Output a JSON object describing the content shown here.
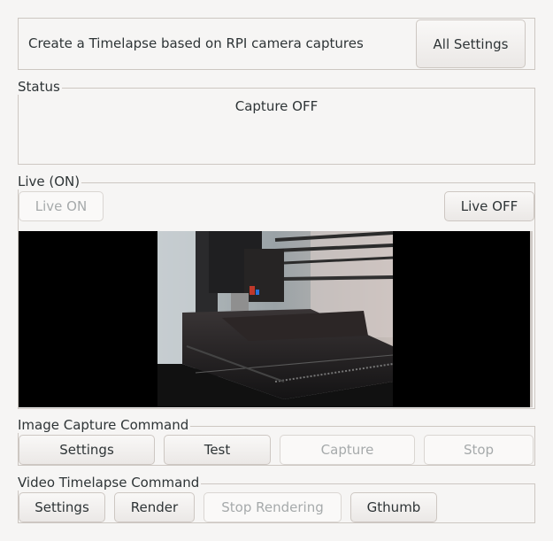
{
  "header": {
    "description": "Create a Timelapse based on RPI camera captures",
    "all_settings_label": "All Settings"
  },
  "status": {
    "legend": "Status",
    "text": "Capture OFF"
  },
  "live": {
    "legend": "Live (ON)",
    "live_on_label": "Live ON",
    "live_off_label": "Live OFF"
  },
  "image_capture": {
    "legend": "Image Capture Command",
    "settings_label": "Settings",
    "test_label": "Test",
    "capture_label": "Capture",
    "stop_label": "Stop"
  },
  "video_timelapse": {
    "legend": "Video Timelapse Command",
    "settings_label": "Settings",
    "render_label": "Render",
    "stop_rendering_label": "Stop Rendering",
    "gthumb_label": "Gthumb"
  },
  "colors": {
    "window_bg": "#f6f5f4",
    "frame_border": "#cdc7c2",
    "disabled_text": "#a6aaab"
  }
}
